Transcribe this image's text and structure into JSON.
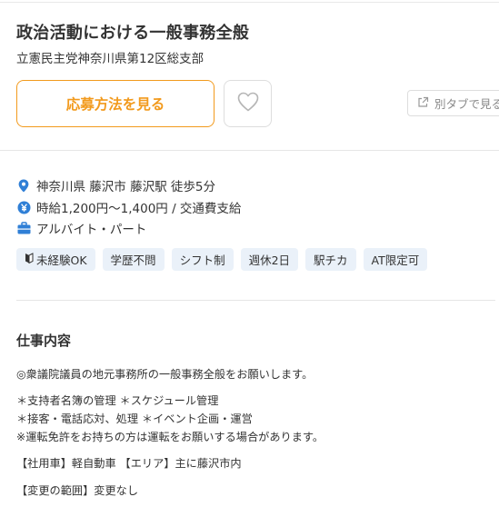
{
  "job": {
    "title": "政治活動における一般事務全般",
    "company": "立憲民主党神奈川県第12区総支部"
  },
  "actions": {
    "apply_label": "応募方法を見る",
    "new_tab_label": "別タブで見る"
  },
  "info": {
    "location": "神奈川県 藤沢市 藤沢駅 徒歩5分",
    "salary": "時給1,200円〜1,400円 / 交通費支給",
    "employment_type": "アルバイト・パート"
  },
  "tags": [
    "未経験OK",
    "学歴不問",
    "シフト制",
    "週休2日",
    "駅チカ",
    "AT限定可"
  ],
  "section": {
    "title": "仕事内容",
    "lines": [
      "◎衆議院議員の地元事務所の一般事務全般をお願いします。",
      "＊支持者名簿の管理 ＊スケジュール管理",
      "＊接客・電話応対、処理 ＊イベント企画・運営",
      "※運転免許をお持ちの方は運転をお願いする場合があります。",
      "【社用車】軽自動車 【エリア】主に藤沢市内",
      "【変更の範囲】変更なし"
    ]
  },
  "colors": {
    "accent": "#f29a1d",
    "icon_blue": "#2f7fd6",
    "tag_bg": "#eaf1f9"
  },
  "icons": {
    "location": "map-pin-icon",
    "salary": "yen-coin-icon",
    "employment": "briefcase-icon",
    "favorite": "heart-icon",
    "new_tab": "external-link-icon",
    "beginner": "beginner-mark-icon"
  }
}
